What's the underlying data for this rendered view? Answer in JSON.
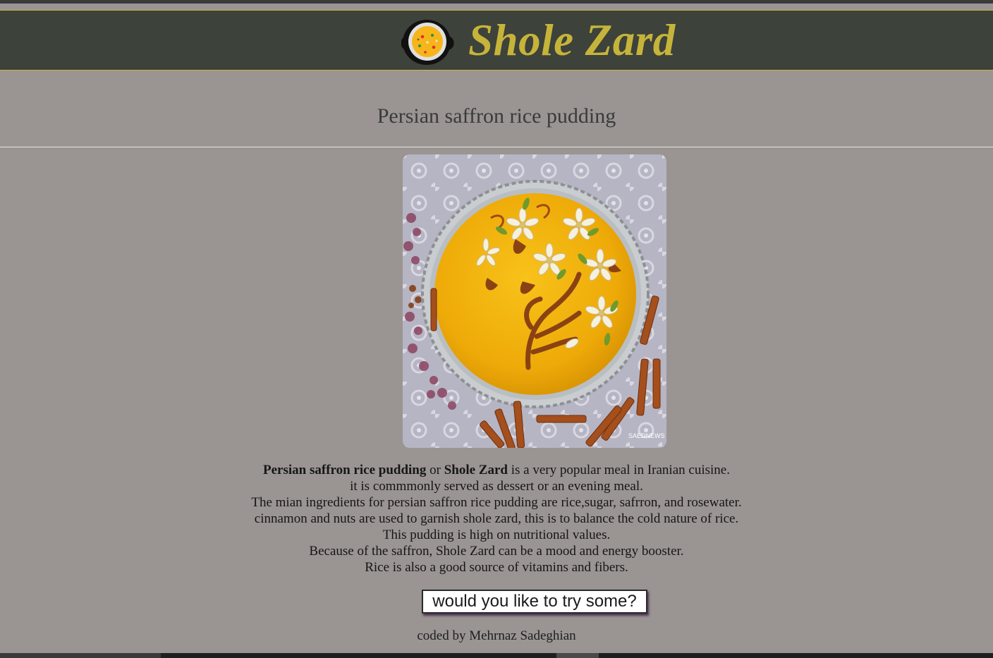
{
  "header": {
    "title": "Shole Zard",
    "logo_icon": "saffron-pudding-pot-icon",
    "brand_color": "#c6b43a",
    "background": "#3d423a"
  },
  "subtitle": "Persian saffron rice pudding",
  "image": {
    "alt": "Persian saffron rice pudding decorated with cinnamon and almond flowers",
    "watermark": "SAEDNEWS"
  },
  "description": {
    "line1_bold1": "Persian saffron rice pudding",
    "line1_mid": " or ",
    "line1_bold2": "Shole Zard",
    "line1_end": " is a very popular meal in Iranian cuisine.",
    "lines": [
      "it is commmonly served as dessert or an evening meal.",
      "The mian ingredients for persian saffron rice pudding are rice,sugar, safrron, and rosewater.",
      "cinnamon and nuts are used to garnish shole zard, this is to balance the cold nature of rice.",
      "This pudding is high on nutritional values.",
      "Because of the saffron, Shole Zard can be a mood and energy booster.",
      "Rice is also a good source of vitamins and fibers."
    ]
  },
  "cta_label": "would you like to try some?",
  "footer": "coded by Mehrnaz Sadeghian",
  "colors": {
    "page_background": "#9a9493",
    "accent_line": "#c9b83a",
    "pudding": "#f2b40d"
  }
}
